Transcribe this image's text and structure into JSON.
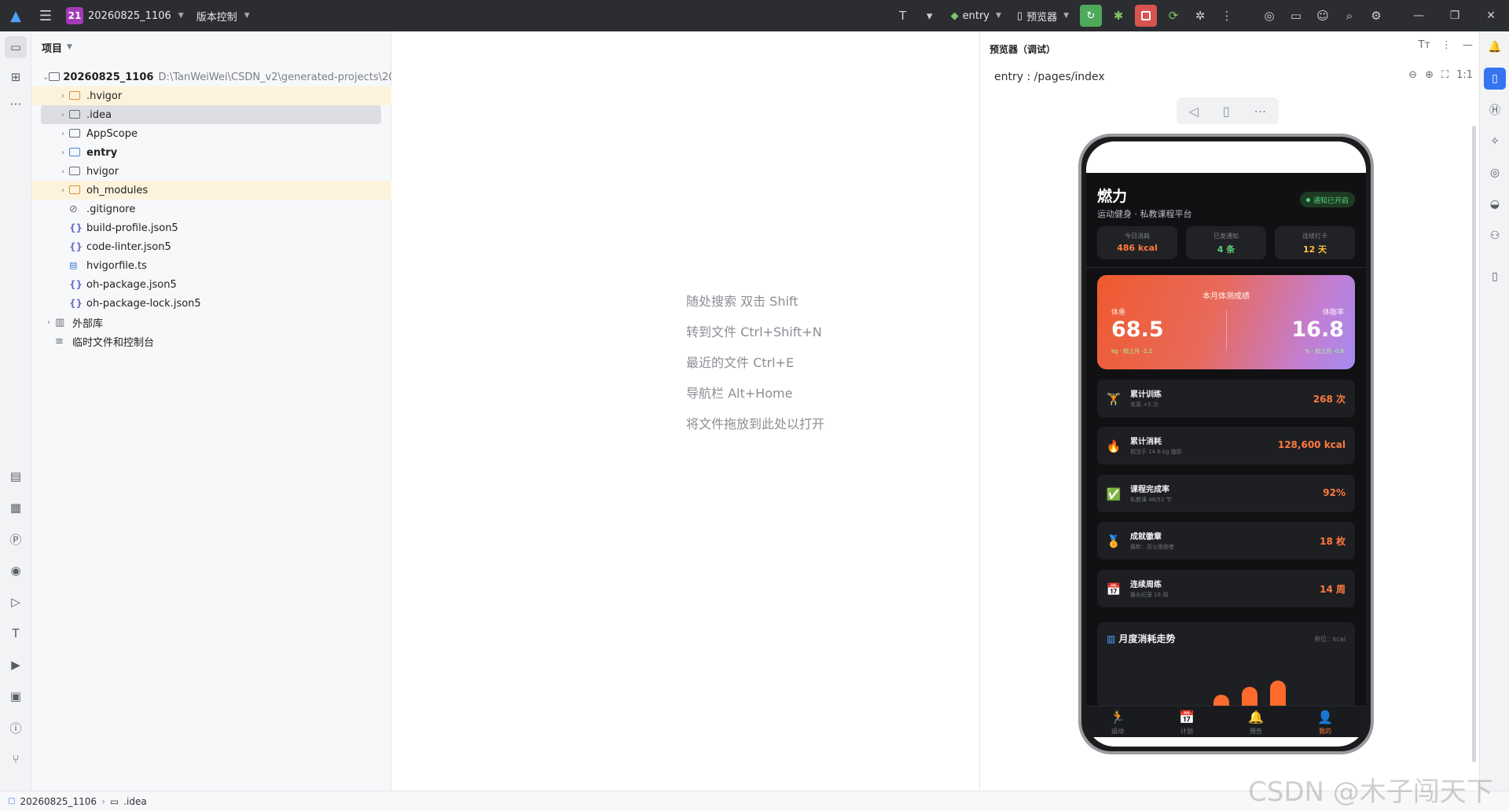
{
  "titlebar": {
    "project_badge": "21",
    "project_name": "20260825_1106",
    "vcs_label": "版本控制",
    "run_config": "entry",
    "device_label": "预览器"
  },
  "project_panel": {
    "header": "项目",
    "root_name": "20260825_1106",
    "root_path": "D:\\TanWeiWei\\CSDN_v2\\generated-projects\\2026082",
    "items": [
      {
        "label": ".hvigor",
        "type": "folder-orange"
      },
      {
        "label": ".idea",
        "type": "folder"
      },
      {
        "label": "AppScope",
        "type": "folder"
      },
      {
        "label": "entry",
        "type": "folder-module"
      },
      {
        "label": "hvigor",
        "type": "folder"
      },
      {
        "label": "oh_modules",
        "type": "folder-orange"
      },
      {
        "label": ".gitignore",
        "type": "ignore"
      },
      {
        "label": "build-profile.json5",
        "type": "json"
      },
      {
        "label": "code-linter.json5",
        "type": "json"
      },
      {
        "label": "hvigorfile.ts",
        "type": "ts"
      },
      {
        "label": "oh-package.json5",
        "type": "json"
      },
      {
        "label": "oh-package-lock.json5",
        "type": "json"
      }
    ],
    "external_libs": "外部库",
    "scratches": "临时文件和控制台"
  },
  "editor_hints": [
    "随处搜索 双击 Shift",
    "转到文件 Ctrl+Shift+N",
    "最近的文件 Ctrl+E",
    "导航栏 Alt+Home",
    "将文件拖放到此处以打开"
  ],
  "previewer": {
    "title": "预览器（调试）",
    "page_path": "entry : /pages/index",
    "zoom_label": "1:1"
  },
  "app": {
    "title": "燃力",
    "subtitle": "运动健身 · 私教课程平台",
    "notif_badge": "通知已开启",
    "stats": [
      {
        "label": "今日消耗",
        "value": "486 kcal",
        "color": "#ff7a3d"
      },
      {
        "label": "已发通知",
        "value": "4 条",
        "color": "#57d37a"
      },
      {
        "label": "连续打卡",
        "value": "12 天",
        "color": "#ffc13d"
      }
    ],
    "hero": {
      "title": "本月体测成绩",
      "left_label": "体重",
      "left_value": "68.5",
      "left_sub": "kg · 较上月 -1.2",
      "right_label": "体脂率",
      "right_value": "16.8",
      "right_sub": "% · 较上月 -0.8"
    },
    "rows": [
      {
        "icon": "🏋",
        "title": "累计训练",
        "sub": "本周 +5 次",
        "value": "268 次"
      },
      {
        "icon": "🔥",
        "title": "累计消耗",
        "sub": "相当于 14.6 kg 脂肪",
        "value": "128,600 kcal"
      },
      {
        "icon": "✅",
        "title": "课程完成率",
        "sub": "私教课 48/52 节",
        "value": "92%"
      },
      {
        "icon": "🏅",
        "title": "成就徽章",
        "sub": "最新：百公里跑者",
        "value": "18 枚"
      },
      {
        "icon": "📅",
        "title": "连续周练",
        "sub": "最长纪录 16 周",
        "value": "14 周"
      }
    ],
    "trend": {
      "title": "月度消耗走势",
      "unit": "单位：kcal"
    },
    "tabs": [
      {
        "icon": "🏃",
        "label": "运动"
      },
      {
        "icon": "📅",
        "label": "计划"
      },
      {
        "icon": "🔔",
        "label": "预告"
      },
      {
        "icon": "👤",
        "label": "我的"
      }
    ]
  },
  "statusbar": {
    "crumb_project": "20260825_1106",
    "crumb_folder": ".idea"
  },
  "watermark": "CSDN @木子闯天下"
}
